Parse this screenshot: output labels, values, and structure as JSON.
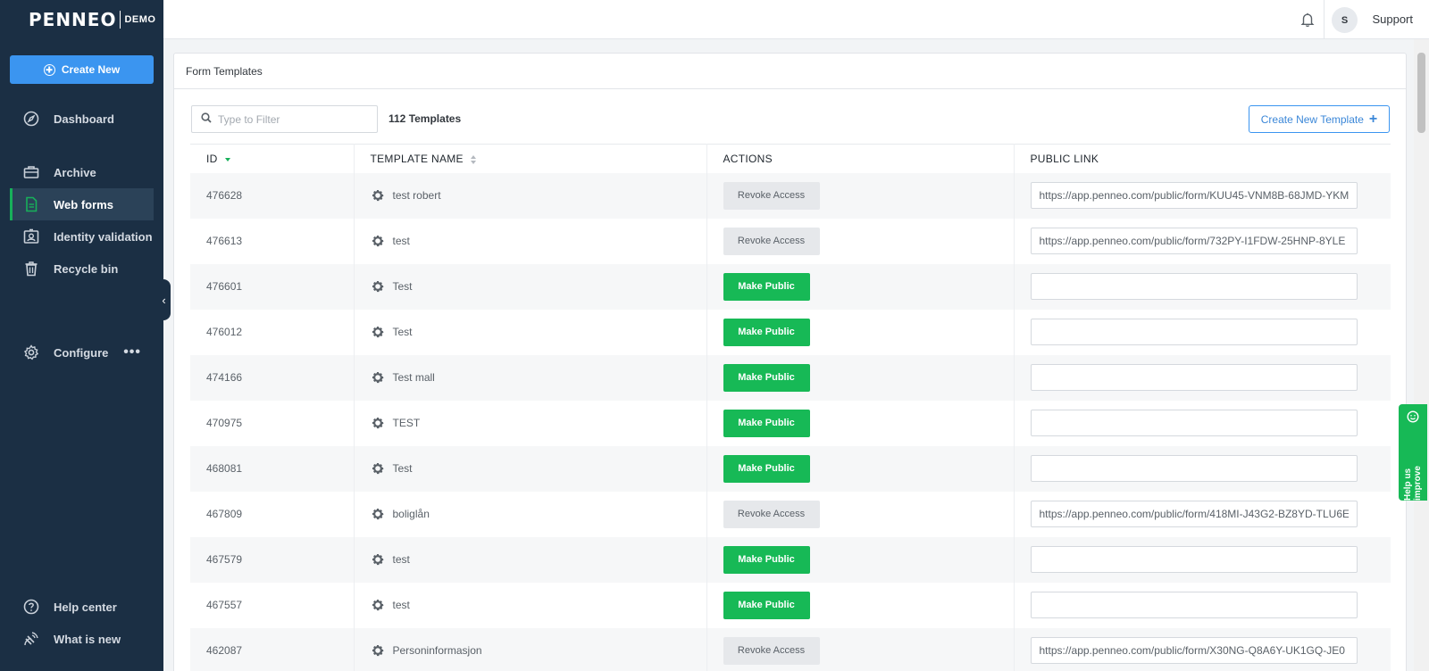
{
  "app": {
    "logo_text": "PENNEO",
    "logo_badge": "DEMO"
  },
  "sidebar": {
    "create_new_label": "Create New",
    "items": [
      {
        "label": "Dashboard",
        "icon": "compass-icon"
      },
      {
        "label": "Archive",
        "icon": "briefcase-icon"
      },
      {
        "label": "Web forms",
        "icon": "document-icon",
        "active": true
      },
      {
        "label": "Identity validation",
        "icon": "id-card-icon"
      },
      {
        "label": "Recycle bin",
        "icon": "trash-icon"
      },
      {
        "label": "Configure",
        "icon": "gear-icon",
        "more": "•••"
      },
      {
        "label": "Help center",
        "icon": "question-circle-icon"
      },
      {
        "label": "What is new",
        "icon": "satellite-icon"
      }
    ]
  },
  "header": {
    "user_initial": "S",
    "user_name": "Support"
  },
  "main": {
    "card_title": "Form Templates",
    "filter_placeholder": "Type to Filter",
    "template_count": "112 Templates",
    "create_template_label": "Create New Template",
    "columns": [
      "ID",
      "TEMPLATE NAME",
      "ACTIONS",
      "PUBLIC LINK"
    ],
    "rows": [
      {
        "id": "476628",
        "name": "test robert",
        "action": "Revoke Access",
        "link": "https://app.penneo.com/public/form/KUU45-VNM8B-68JMD-YKM"
      },
      {
        "id": "476613",
        "name": "test",
        "action": "Revoke Access",
        "link": "https://app.penneo.com/public/form/732PY-I1FDW-25HNP-8YLE"
      },
      {
        "id": "476601",
        "name": "Test",
        "action": "Make Public",
        "link": ""
      },
      {
        "id": "476012",
        "name": "Test",
        "action": "Make Public",
        "link": ""
      },
      {
        "id": "474166",
        "name": "Test mall",
        "action": "Make Public",
        "link": ""
      },
      {
        "id": "470975",
        "name": "TEST",
        "action": "Make Public",
        "link": ""
      },
      {
        "id": "468081",
        "name": "Test",
        "action": "Make Public",
        "link": ""
      },
      {
        "id": "467809",
        "name": "boliglån",
        "action": "Revoke Access",
        "link": "https://app.penneo.com/public/form/418MI-J43G2-BZ8YD-TLU6E"
      },
      {
        "id": "467579",
        "name": "test",
        "action": "Make Public",
        "link": ""
      },
      {
        "id": "467557",
        "name": "test",
        "action": "Make Public",
        "link": ""
      },
      {
        "id": "462087",
        "name": "Personinformasjon",
        "action": "Revoke Access",
        "link": "https://app.penneo.com/public/form/X30NG-Q8A6Y-UK1GQ-JE0"
      }
    ]
  },
  "feedback": {
    "label": "Help us improve"
  },
  "colors": {
    "sidebar_bg": "#1b2f44",
    "accent_blue": "#3b95f0",
    "accent_green": "#17b956"
  }
}
